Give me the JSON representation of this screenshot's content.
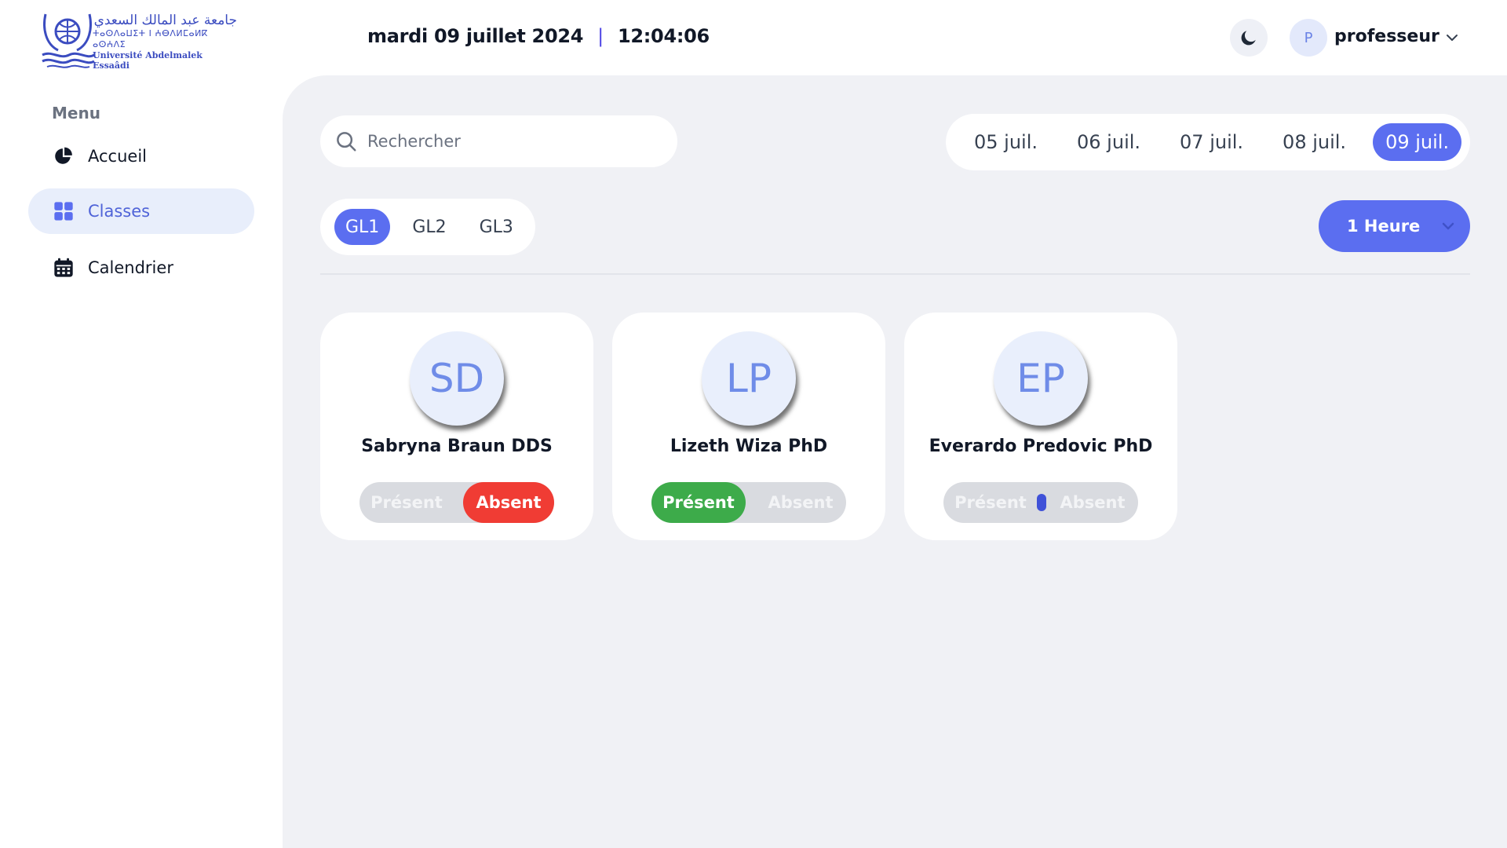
{
  "header": {
    "logo": {
      "arabic": "جامعة عبد المالك السعدي",
      "tifinagh": "ⵜⴰⵙⴷⴰⵡⵉⵜ ⵏ ⵄⴱⴷⵍⵎⴰⵍⴽ ⴰⵙⵄⴷⵉ",
      "french": "Université Abdelmalek Essaâdi",
      "color": "#3b4cc0"
    },
    "date": "mardi 09 juillet 2024",
    "separator": "|",
    "time": "12:04:06",
    "theme_icon": "moon-icon",
    "user": {
      "avatar_initial": "P",
      "name": "professeur",
      "chevron_icon": "chevron-down-icon"
    }
  },
  "sidebar": {
    "menu_title": "Menu",
    "items": [
      {
        "label": "Accueil",
        "icon": "pie-chart-icon",
        "active": false
      },
      {
        "label": "Classes",
        "icon": "grid-icon",
        "active": true
      },
      {
        "label": "Calendrier",
        "icon": "calendar-icon",
        "active": false
      }
    ]
  },
  "main": {
    "search": {
      "placeholder": "Rechercher",
      "value": "",
      "icon": "search-icon"
    },
    "dates": [
      {
        "label": "05 juil.",
        "active": false
      },
      {
        "label": "06 juil.",
        "active": false
      },
      {
        "label": "07 juil.",
        "active": false
      },
      {
        "label": "08 juil.",
        "active": false
      },
      {
        "label": "09 juil.",
        "active": true
      }
    ],
    "classes": [
      {
        "label": "GL1",
        "active": true
      },
      {
        "label": "GL2",
        "active": false
      },
      {
        "label": "GL3",
        "active": false
      }
    ],
    "duration": {
      "label": "1 Heure",
      "icon": "chevron-down-icon"
    },
    "students": [
      {
        "initials": "SD",
        "name": "Sabryna Braun DDS",
        "status": "absent"
      },
      {
        "initials": "LP",
        "name": "Lizeth Wiza PhD",
        "status": "present"
      },
      {
        "initials": "EP",
        "name": "Everardo Predovic PhD",
        "status": "none"
      }
    ],
    "toggle_labels": {
      "present": "Présent",
      "absent": "Absent"
    }
  },
  "colors": {
    "accent": "#5b6ef0",
    "present": "#3dab4a",
    "absent": "#f03c34",
    "background": "#f0f1f5"
  }
}
